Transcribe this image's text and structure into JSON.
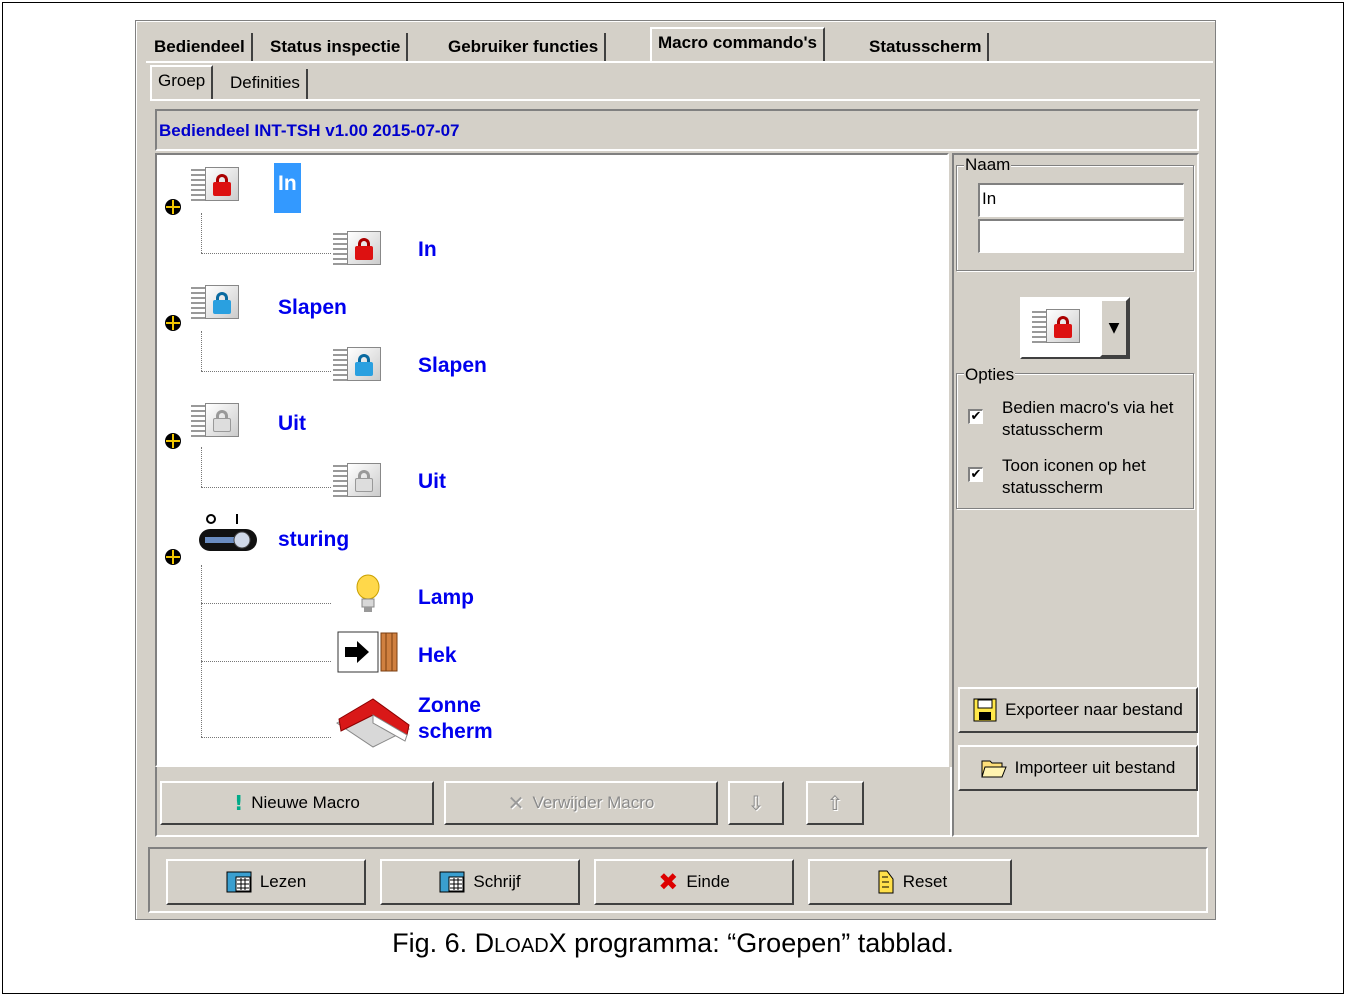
{
  "tabs": [
    "Bediendeel",
    "Status inspectie",
    "Gebruiker functies",
    "Macro commando's",
    "Statusscherm"
  ],
  "subtabs": [
    "Groep",
    "Definities"
  ],
  "header": "Bediendeel INT-TSH v1.00 2015-07-07",
  "tree": {
    "groups": [
      {
        "label": "In",
        "child": "In",
        "icon": "lock-red-icon"
      },
      {
        "label": "Slapen",
        "child": "Slapen",
        "icon": "lock-blue-icon"
      },
      {
        "label": "Uit",
        "child": "Uit",
        "icon": "lock-grey-icon"
      },
      {
        "label": "sturing",
        "children": [
          "Lamp",
          "Hek",
          "Zonne",
          "scherm"
        ],
        "icon": "switch-icon"
      }
    ]
  },
  "tree_buttons": {
    "new_macro": "Nieuwe Macro",
    "delete_macro": "Verwijder Macro"
  },
  "right": {
    "name_legend": "Naam",
    "name_value1": "In",
    "name_value2": "",
    "options_legend": "Opties",
    "option1_line1": "Bedien macro's via het",
    "option1_line2": "statusscherm",
    "option2_line1": "Toon iconen op het",
    "option2_line2": "statusscherm",
    "option1_checked": "✔",
    "option2_checked": "✔",
    "export": "Exporteer naar bestand",
    "import": "Importeer uit bestand"
  },
  "bottom": {
    "read": "Lezen",
    "write": "Schrijf",
    "end": "Einde",
    "reset": "Reset"
  },
  "caption": {
    "prefix": "Fig. 6. D",
    "small1": "LOAD",
    "mid": "X programma: “Groepen” tabblad."
  }
}
